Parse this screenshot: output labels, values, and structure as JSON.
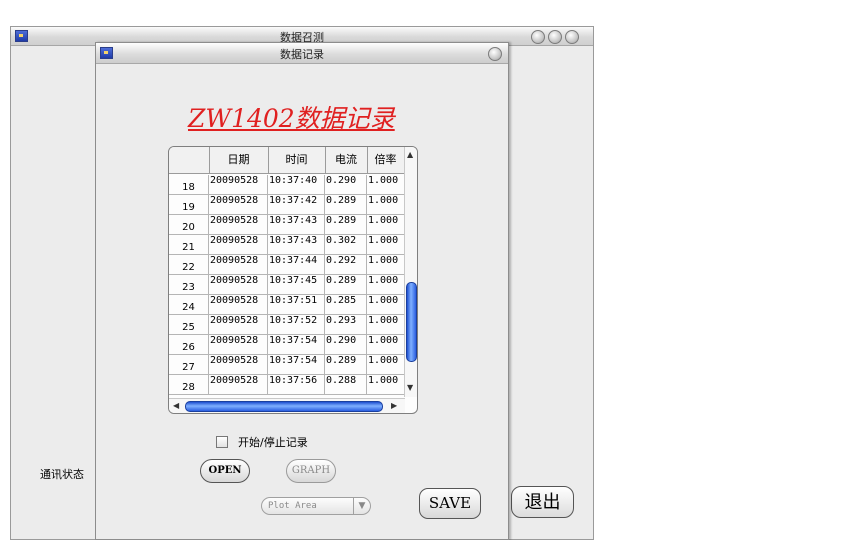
{
  "outer_window": {
    "title": "数据召测",
    "status_label": "通讯状态",
    "exit_label": "退出"
  },
  "inner_window": {
    "title": "数据记录",
    "heading": "ZW1402数据记录",
    "table": {
      "columns": [
        "",
        "日期",
        "时间",
        "电流",
        "倍率"
      ],
      "rows": [
        [
          "18",
          "20090528",
          "10:37:40",
          "0.290",
          "1.000"
        ],
        [
          "19",
          "20090528",
          "10:37:42",
          "0.289",
          "1.000"
        ],
        [
          "20",
          "20090528",
          "10:37:43",
          "0.289",
          "1.000"
        ],
        [
          "21",
          "20090528",
          "10:37:43",
          "0.302",
          "1.000"
        ],
        [
          "22",
          "20090528",
          "10:37:44",
          "0.292",
          "1.000"
        ],
        [
          "23",
          "20090528",
          "10:37:45",
          "0.289",
          "1.000"
        ],
        [
          "24",
          "20090528",
          "10:37:51",
          "0.285",
          "1.000"
        ],
        [
          "25",
          "20090528",
          "10:37:52",
          "0.293",
          "1.000"
        ],
        [
          "26",
          "20090528",
          "10:37:54",
          "0.290",
          "1.000"
        ],
        [
          "27",
          "20090528",
          "10:37:54",
          "0.289",
          "1.000"
        ],
        [
          "28",
          "20090528",
          "10:37:56",
          "0.288",
          "1.000"
        ]
      ]
    },
    "checkbox_label": "开始/停止记录",
    "open_label": "OPEN",
    "graph_label": "GRAPH",
    "plot_select": "Plot Area",
    "save_label": "SAVE"
  },
  "colors": {
    "heading": "#e02020",
    "scroll_thumb": "#2a5ee0"
  }
}
